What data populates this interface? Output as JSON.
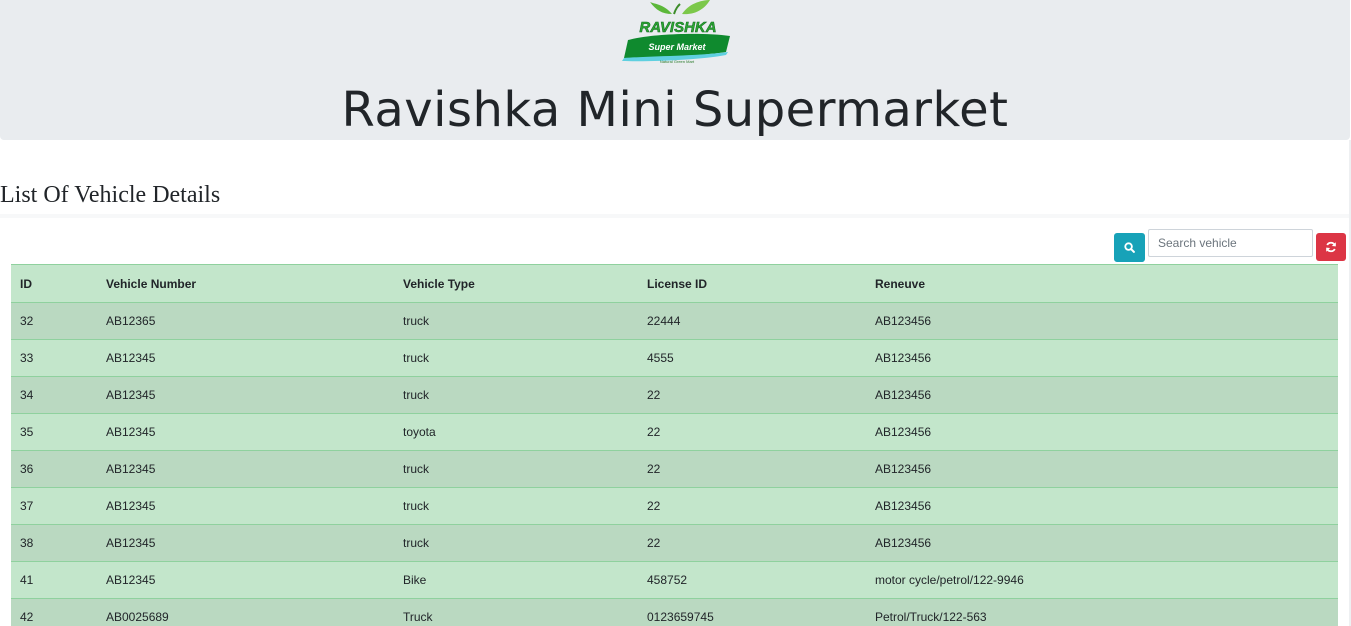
{
  "header": {
    "logo": {
      "brand": "RAVISHKA",
      "sub": "Super Market",
      "tagline": "Natural Green Mart"
    },
    "title": "Ravishka Mini Supermarket"
  },
  "section": {
    "title": "List Of Vehicle Details"
  },
  "toolbar": {
    "search_icon": "search-icon",
    "search_placeholder": "Search vehicle",
    "refresh_icon": "refresh-icon"
  },
  "colors": {
    "search_button": "#17a2b8",
    "refresh_button": "#dc3545",
    "table_row": "#c3e6cb",
    "table_row_alt": "#bad9c1"
  },
  "table": {
    "headers": [
      "ID",
      "Vehicle Number",
      "Vehicle Type",
      "License ID",
      "Reneuve"
    ],
    "rows": [
      [
        "32",
        "AB12365",
        "truck",
        "22444",
        "AB123456"
      ],
      [
        "33",
        "AB12345",
        "truck",
        "4555",
        "AB123456"
      ],
      [
        "34",
        "AB12345",
        "truck",
        "22",
        "AB123456"
      ],
      [
        "35",
        "AB12345",
        "toyota",
        "22",
        "AB123456"
      ],
      [
        "36",
        "AB12345",
        "truck",
        "22",
        "AB123456"
      ],
      [
        "37",
        "AB12345",
        "truck",
        "22",
        "AB123456"
      ],
      [
        "38",
        "AB12345",
        "truck",
        "22",
        "AB123456"
      ],
      [
        "41",
        "AB12345",
        "Bike",
        "458752",
        "motor cycle/petrol/122-9946"
      ],
      [
        "42",
        "AB0025689",
        "Truck",
        "0123659745",
        "Petrol/Truck/122-563"
      ]
    ]
  }
}
